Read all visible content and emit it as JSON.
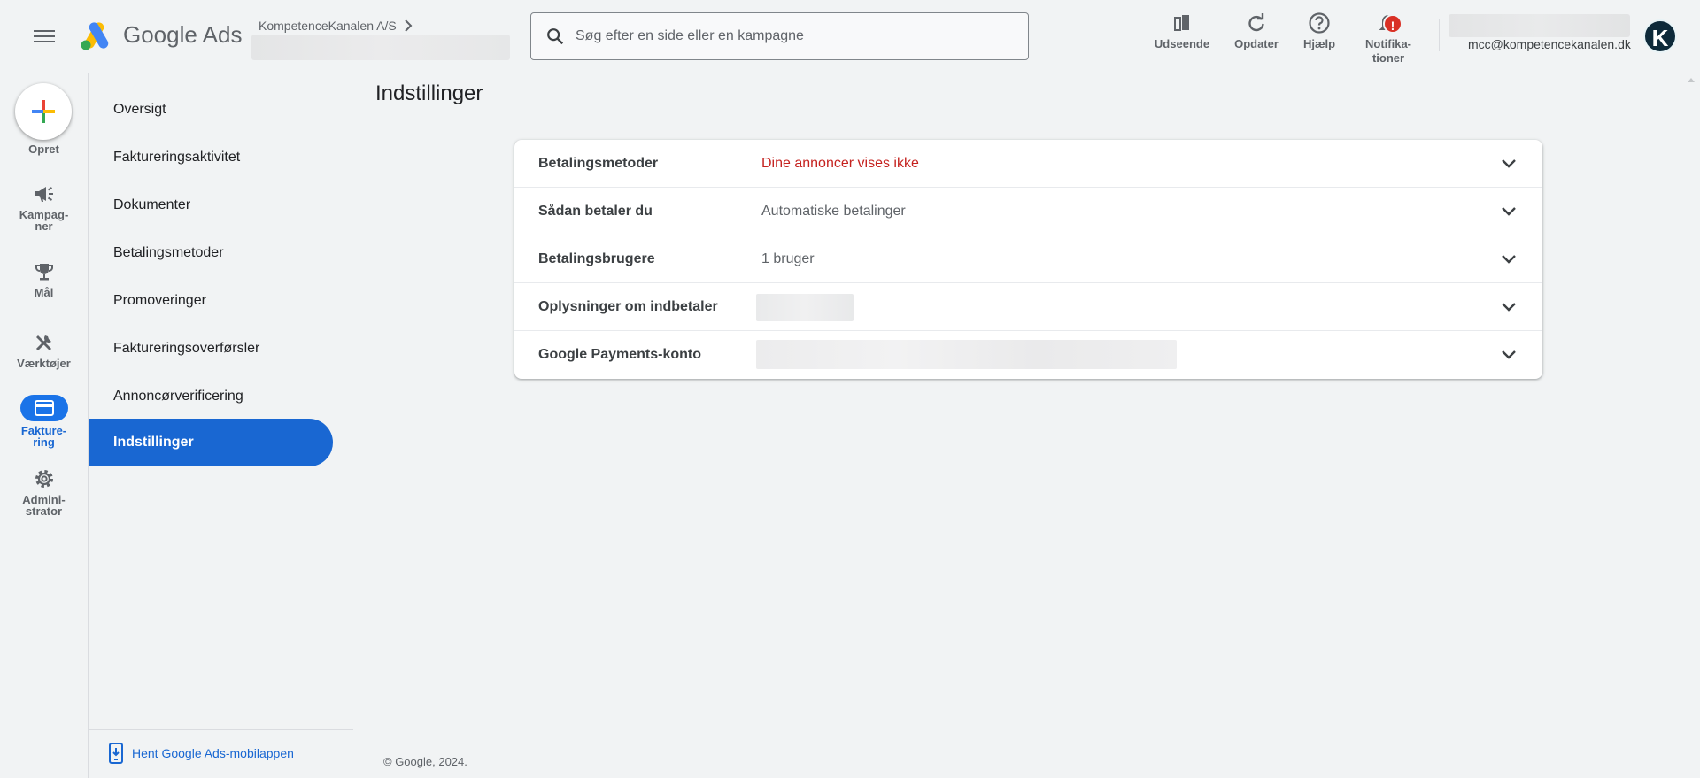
{
  "header": {
    "brand_google": "Google",
    "brand_ads": "Ads",
    "account_name": "KompetenceKanalen A/S",
    "search_placeholder": "Søg efter en side eller en kampagne",
    "tools": [
      {
        "icon": "appearance-icon",
        "label": "Udseende"
      },
      {
        "icon": "refresh-icon",
        "label": "Opdater"
      },
      {
        "icon": "help-icon",
        "label": "Hjælp"
      },
      {
        "icon": "bell-icon",
        "label_line1": "Notifika-",
        "label_line2": "tioner",
        "badge": "!"
      }
    ],
    "user_email": "mcc@kompetencekanalen.dk",
    "avatar_letter": "K"
  },
  "rail": {
    "create_label": "Opret",
    "items": [
      {
        "icon": "megaphone-icon",
        "line1": "Kampag-",
        "line2": "ner"
      },
      {
        "icon": "trophy-icon",
        "line1": "Mål",
        "line2": ""
      },
      {
        "icon": "tools-icon",
        "line1": "Værktøjer",
        "line2": ""
      },
      {
        "icon": "credit-card-icon",
        "line1": "Fakture-",
        "line2": "ring",
        "active": true
      },
      {
        "icon": "gear-icon",
        "line1": "Admini-",
        "line2": "strator"
      }
    ]
  },
  "subnav": {
    "items": [
      {
        "label": "Oversigt"
      },
      {
        "label": "Faktureringsaktivitet"
      },
      {
        "label": "Dokumenter"
      },
      {
        "label": "Betalingsmetoder"
      },
      {
        "label": "Promoveringer"
      },
      {
        "label": "Faktureringsoverførsler"
      },
      {
        "label": "Annoncørverificering"
      },
      {
        "label": "Indstillinger",
        "active": true
      }
    ],
    "footer_link": "Hent Google Ads-mobilappen"
  },
  "main": {
    "title": "Indstillinger",
    "rows": [
      {
        "key": "Betalingsmetoder",
        "value": "Dine annoncer vises ikke",
        "status_color": "#c5221f"
      },
      {
        "key": "Sådan betaler du",
        "value": "Automatiske betalinger"
      },
      {
        "key": "Betalingsbrugere",
        "value": "1 bruger"
      },
      {
        "key": "Oplysninger om indbetaler",
        "value": ""
      },
      {
        "key": "Google Payments-konto",
        "value": ""
      }
    ]
  },
  "footer": {
    "copyright": "© Google, 2024."
  },
  "colors": {
    "accent": "#1967d2",
    "warning": "#c5221f",
    "background": "#f1f3f4"
  }
}
